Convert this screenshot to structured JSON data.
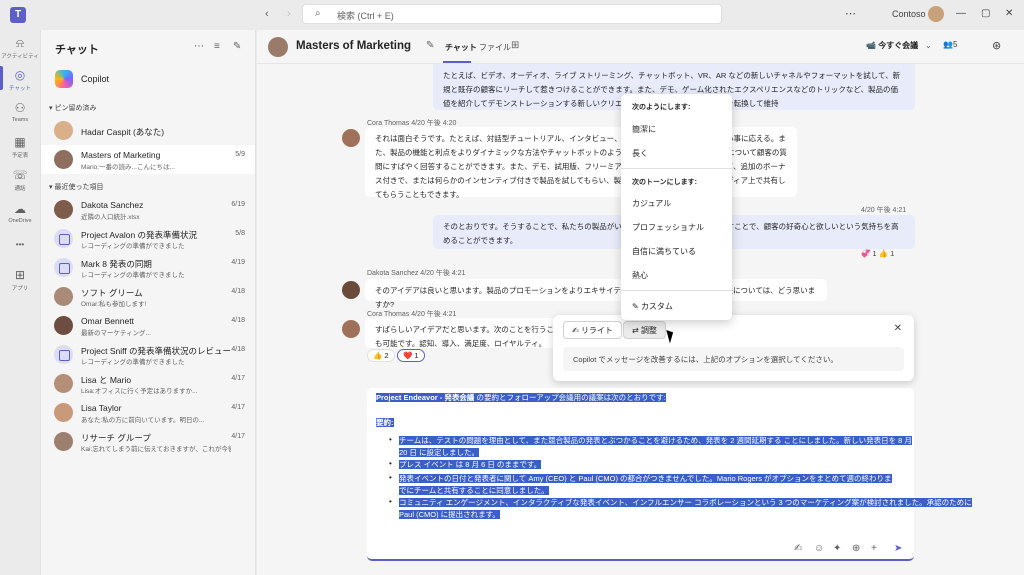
{
  "titlebar": {
    "search_placeholder": "検索 (Ctrl + E)",
    "more": "⋯",
    "org": "Contoso",
    "minimize": "—",
    "restore": "▢",
    "close": "✕"
  },
  "rail": [
    {
      "label": "アクティビティ",
      "icon": "bell-icon",
      "glyph": "⍾"
    },
    {
      "label": "チャット",
      "icon": "chat-icon",
      "glyph": "◎"
    },
    {
      "label": "Teams",
      "icon": "teams-icon",
      "glyph": "⚇"
    },
    {
      "label": "予定表",
      "icon": "calendar-icon",
      "glyph": "▦"
    },
    {
      "label": "通話",
      "icon": "phone-icon",
      "glyph": "☏"
    },
    {
      "label": "OneDrive",
      "icon": "cloud-icon",
      "glyph": "☁"
    },
    {
      "label": "•••",
      "icon": "more-icon",
      "glyph": ""
    },
    {
      "label": "アプリ",
      "icon": "apps-icon",
      "glyph": "⊞"
    }
  ],
  "chatlist": {
    "title": "チャット",
    "copilot_label": "Copilot",
    "pinned_header": "▾ ピン留め済み",
    "recent_header": "▾ 最近使った項目",
    "pinned": [
      {
        "name": "Hadar Caspit (あなた)",
        "preview": "",
        "date": ""
      },
      {
        "name": "Masters of Marketing",
        "preview": "Mario:一番の読み...こんにちは...",
        "date": "5/9"
      }
    ],
    "recent": [
      {
        "name": "Dakota Sanchez",
        "preview": "近隣の人口統計.xlsx",
        "date": "6/19",
        "group": false
      },
      {
        "name": "Project Avalon の発表準備状況",
        "preview": "レコーディングの準備ができました",
        "date": "5/8",
        "group": true
      },
      {
        "name": "Mark 8 発表の同期",
        "preview": "レコーディングの準備ができました",
        "date": "4/19",
        "group": true
      },
      {
        "name": "ソフト グリーム",
        "preview": "Omar:私も参加します!",
        "date": "4/18",
        "group": false
      },
      {
        "name": "Omar Bennett",
        "preview": "最新のマーケティング...",
        "date": "4/18",
        "group": false
      },
      {
        "name": "Project Sniff の発表準備状況のレビュー",
        "preview": "レコーディングの準備ができました",
        "date": "4/18",
        "group": true
      },
      {
        "name": "Lisa と Mario",
        "preview": "Lisa:オフィスに行く予定はありますか...",
        "date": "4/17",
        "group": false
      },
      {
        "name": "Lisa Taylor",
        "preview": "あなた:私の方に前向いています。明日の...",
        "date": "4/17",
        "group": false
      },
      {
        "name": "リサーチ グループ",
        "preview": "Kai:忘れてしまう前に伝えておきますが、これが今後役立つ...",
        "date": "4/17",
        "group": false
      }
    ]
  },
  "main": {
    "title": "Masters of Marketing",
    "tabs": [
      "チャット",
      "ファイル"
    ],
    "meet_now": "今すぐ会議",
    "people_count": "5"
  },
  "messages": {
    "m1": "たとえば、ビデオ、オーディオ、ライブ ストリーミング、チャットボット、VR、AR などの新しいチャネルやフォーマットを試して、新規と既存の顧客にリーチして惹きつけることができます。また、デモ、ゲーム化されたエクスペリエンスなどのトリックなど、製品の価値を紹介してデモンストレーションする新しいクリエイティブな方法を試して、顧客を転換して維持",
    "cora1_meta": "Cora Thomas  4/20 午後 4:20",
    "cora1": "それは面白そうです。たとえば、対話型チュートリアル、インタビュー、体験談などを試して、顧客の関心事に応える。また、製品の機能と利点をよりダイナミックな方法やチャットボットのような会話型の方法で紹介する製品について顧客の質問にすばやく回答することができます。また、デモ、試用版、フリーミアム、紹介プログラムなども試して、追加のボーナス付きで、または何らかのインセンティブ付きで製品を試してもらい、製品を友達や同僚、ソーシャルメディア上で共有してもらうこともできます。",
    "me2_meta": "4/20 午後 4:21",
    "me2": "そのとおりです。そうすることで、私たちの製品がいかに革新的で有益であるかを示すことで、顧客の好奇心と欲しいという気持ちを高めることができます。",
    "react1": "💞 1   👍 1",
    "dakota_meta": "Dakota Sanchez  4/20 午後 4:21",
    "dakota": "そのアイデアは良いと思います。製品のプロモーションをよりエキサイティングで魅力的なものにする方法については、どう思いますか?",
    "cora2_meta": "Cora Thomas  4/20 午後 4:21",
    "cora2": "すばらしいアイデアだと思います。次のことを行うことも可能です。認知、導入、満足度、ロイヤルティ。",
    "react2_a": "👍 2",
    "react2_b": "❤️ 1"
  },
  "rewrite": {
    "rewrite_label": "リライト",
    "adjust_label": "調整",
    "hint": "Copilot でメッセージを改善するには、上記のオプションを選択してください。",
    "close": "✕"
  },
  "menu": {
    "length_header": "次のようにします:",
    "length_items": [
      "簡潔に",
      "長く"
    ],
    "tone_header": "次のトーンにします:",
    "tone_items": [
      "カジュアル",
      "プロフェッショナル",
      "自信に満ちている",
      "熱心"
    ],
    "custom": "カスタム"
  },
  "compose": {
    "heading_bold": "Project Endeavor - 発表会議",
    "heading_rest": " の要約とフォローアップ会議用の議案は次のとおりです:",
    "summary": "要約:",
    "b1_l1": "チームは、テストの問題を理由として、また競合製品の発表とぶつかることを避けるため、発表を 2 週間延期する ことにしました。新しい発表日を 8 月",
    "b1_l2": "20 日 に設定しました。",
    "b2": "プレス イベント は 8 月 6 日 のままです。",
    "b3_l1": "発表イベントの日付と発表者に関して Amy (CEO) と Paul (CMO) の都合がつきませんでした。Mario Rogers がオプションをまとめて週の終わりま",
    "b3_l2": "でにチームと共有することに同意しました。",
    "b4_l1": "コミュニティ エンゲージメント、インタラクティブな発表イベント、インフルエンサー コラボレーションという 3 つのマーケティング案が検討されました。承認のために",
    "b4_l2": "Paul (CMO) に提出されます。"
  }
}
